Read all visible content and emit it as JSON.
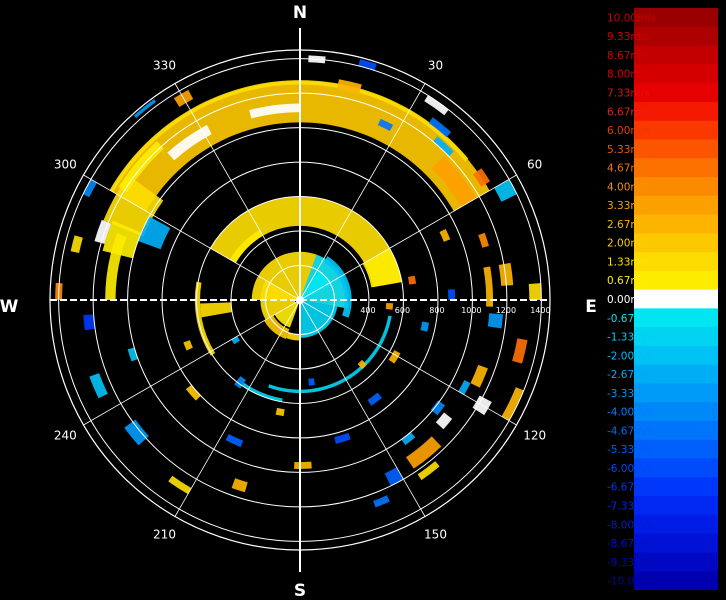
{
  "chart_data": {
    "type": "polar-radar-ppi",
    "cardinals": {
      "north": "N",
      "east": "E",
      "south": "S",
      "west": "W"
    },
    "azimuth_labels": [
      {
        "angle": 30,
        "text": "30"
      },
      {
        "angle": 60,
        "text": "60"
      },
      {
        "angle": 120,
        "text": "120"
      },
      {
        "angle": 150,
        "text": "150"
      },
      {
        "angle": 210,
        "text": "210"
      },
      {
        "angle": 240,
        "text": "240"
      },
      {
        "angle": 300,
        "text": "300"
      },
      {
        "angle": 330,
        "text": "330"
      }
    ],
    "range_rings": [
      200,
      400,
      600,
      800,
      1000,
      1200,
      1400
    ],
    "range_labels": [
      {
        "value": 400,
        "text": "400"
      },
      {
        "value": 600,
        "text": "600"
      },
      {
        "value": 800,
        "text": "800"
      },
      {
        "value": 1000,
        "text": "1000"
      },
      {
        "value": 1200,
        "text": "1200"
      },
      {
        "value": 1400,
        "text": "1400"
      }
    ],
    "colorbar": {
      "labels": [
        "10.00m/s",
        "9.33m/s",
        "8.67m/s",
        "8.00m/s",
        "7.33m/s",
        "6.67m/s",
        "6.00m/s",
        "5.33m/s",
        "4.67m/s",
        "4.00m/s",
        "3.33m/s",
        "2.67m/s",
        "2.00m/s",
        "1.33m/s",
        "0.67m/s",
        "0.00m/s",
        "-0.67m/s",
        "-1.33m/s",
        "-2.00m/s",
        "-2.67m/s",
        "-3.33m/s",
        "-4.00m/s",
        "-4.67m/s",
        "-5.33m/s",
        "-6.00m/s",
        "-6.67m/s",
        "-7.33m/s",
        "-8.00m/s",
        "-8.67m/s",
        "-9.33m/s",
        "-10.00m/s"
      ],
      "colors": [
        "#9a0000",
        "#ad0000",
        "#c20000",
        "#d40000",
        "#e60000",
        "#f51800",
        "#fa3800",
        "#fc5500",
        "#fc7000",
        "#fc8a00",
        "#fca000",
        "#fcb400",
        "#fcc800",
        "#fcdc00",
        "#fcec00",
        "#ffffff",
        "#00e6f0",
        "#00d4f2",
        "#00c2f4",
        "#00aef6",
        "#009af8",
        "#0088f9",
        "#0074fa",
        "#0060fb",
        "#004cfc",
        "#0038fb",
        "#0028f3",
        "#001ce6",
        "#0012d6",
        "#0008c4",
        "#0000b0"
      ],
      "label_colors": [
        "#c80000",
        "#cc0000",
        "#d20000",
        "#d80000",
        "#de1010",
        "#e42020",
        "#ea3a00",
        "#ee5a00",
        "#f07600",
        "#f39000",
        "#f6a600",
        "#f8ba00",
        "#fad000",
        "#fce200",
        "#fcf000",
        "#ffffff",
        "#00e4f0",
        "#00d0f0",
        "#00bef2",
        "#00aaf4",
        "#0096f6",
        "#0082f8",
        "#006ef8",
        "#005cf8",
        "#0048f8",
        "#0036f0",
        "#0028e4",
        "#001cd6",
        "#0012c6",
        "#000ab6",
        "#0004a6"
      ]
    },
    "max_range": 1450,
    "cells": [
      {
        "az_from": 300,
        "az_to": 420,
        "r_from": 1030,
        "r_to": 1270,
        "v": 2.2
      },
      {
        "az_from": 292,
        "az_to": 306,
        "r_from": 980,
        "r_to": 1230,
        "v": 1.2
      },
      {
        "az_from": 284,
        "az_to": 293,
        "r_from": 1000,
        "r_to": 1180,
        "v": 1.0
      },
      {
        "az_from": 302,
        "az_to": 318,
        "r_from": 1180,
        "r_to": 1240,
        "v": 0.4
      },
      {
        "az_from": 405,
        "az_to": 420,
        "r_from": 1080,
        "r_to": 1180,
        "v": 3.2
      },
      {
        "az_from": 300,
        "az_to": 410,
        "r_from": 1250,
        "r_to": 1275,
        "v": 1.6
      },
      {
        "az_from": 290,
        "az_to": 299,
        "r_from": 860,
        "r_to": 1000,
        "v": -2.6
      },
      {
        "az_from": 270,
        "az_to": 290,
        "r_from": 1070,
        "r_to": 1130,
        "v": 1.0
      },
      {
        "az_from": 318,
        "az_to": 332,
        "r_from": 1090,
        "r_to": 1150,
        "v": 0.0
      },
      {
        "az_from": 345,
        "az_to": 360,
        "r_from": 1090,
        "r_to": 1140,
        "v": 0.0
      },
      {
        "az_from": 286,
        "az_to": 292,
        "r_from": 1180,
        "r_to": 1240,
        "v": 0.0
      },
      {
        "az_from": 300,
        "az_to": 440,
        "r_from": 430,
        "r_to": 600,
        "v": 1.6
      },
      {
        "az_from": 420,
        "az_to": 440,
        "r_from": 420,
        "r_to": 600,
        "v": 0.9
      },
      {
        "az_from": 300,
        "az_to": 330,
        "r_from": 430,
        "r_to": 470,
        "v": 0.8
      },
      {
        "az_from": 270,
        "az_to": 460,
        "r_from": 0,
        "r_to": 280,
        "v": 1.3
      },
      {
        "az_from": 380,
        "az_to": 460,
        "r_from": 0,
        "r_to": 280,
        "v": -1.6
      },
      {
        "az_from": 392,
        "az_to": 425,
        "r_from": 0,
        "r_to": 200,
        "v": -0.7
      },
      {
        "az_from": 392,
        "az_to": 470,
        "r_from": 260,
        "r_to": 300,
        "v": -2.0
      },
      {
        "az_from": 460,
        "az_to": 540,
        "r_from": 0,
        "r_to": 220,
        "v": -1.6
      },
      {
        "az_from": 460,
        "az_to": 560,
        "r_from": 520,
        "r_to": 540,
        "v": -1.3
      },
      {
        "az_from": 550,
        "az_to": 575,
        "r_from": 580,
        "r_to": 600,
        "v": -1.6
      },
      {
        "az_from": 540,
        "az_to": 560,
        "r_from": 200,
        "r_to": 235,
        "v": 1.3
      },
      {
        "az_from": 560,
        "az_to": 600,
        "r_from": 180,
        "r_to": 240,
        "v": 2.0
      },
      {
        "az_from": 600,
        "az_to": 660,
        "r_from": 30,
        "r_to": 230,
        "v": 1.3
      },
      {
        "az_from": 560,
        "az_to": 600,
        "r_from": 0,
        "r_to": 170,
        "v": 0.5
      },
      {
        "az_from": 238,
        "az_to": 280,
        "r_from": 580,
        "r_to": 610,
        "v": 1.3
      },
      {
        "az_from": 260,
        "az_to": 268,
        "r_from": 400,
        "r_to": 580,
        "v": 1.2
      },
      {
        "az_from": 440,
        "az_to": 452,
        "r_from": 1080,
        "r_to": 1120,
        "v": 2.4
      },
      {
        "az_from": 440,
        "az_to": 446,
        "r_from": 1170,
        "r_to": 1240,
        "v": 3.0
      },
      {
        "az_from": 476,
        "az_to": 480,
        "r_from": 1060,
        "r_to": 1100,
        "v": -2.8
      },
      {
        "az_from": 472,
        "az_to": 480,
        "r_from": 1350,
        "r_to": 1400,
        "v": 3.0
      },
      {
        "az_from": 478,
        "az_to": 482,
        "r_from": 1180,
        "r_to": 1260,
        "v": 0.0
      },
      {
        "az_from": 496,
        "az_to": 506,
        "r_from": 1100,
        "r_to": 1180,
        "v": 3.2
      },
      {
        "az_from": 500,
        "az_to": 506,
        "r_from": 1220,
        "r_to": 1260,
        "v": 1.4
      },
      {
        "az_from": 486,
        "az_to": 490,
        "r_from": 990,
        "r_to": 1040,
        "v": -4.0
      },
      {
        "az_from": 414,
        "az_to": 418,
        "r_from": 1240,
        "r_to": 1300,
        "v": 4.5
      },
      {
        "az_from": 392,
        "az_to": 398,
        "r_from": 1360,
        "r_to": 1400,
        "v": 0.0
      },
      {
        "az_from": 328,
        "az_to": 332,
        "r_from": 1320,
        "r_to": 1380,
        "v": 3.4
      },
      {
        "az_from": 318,
        "az_to": 324,
        "r_from": 1420,
        "r_to": 1440,
        "v": -3.6
      },
      {
        "az_from": 296,
        "az_to": 300,
        "r_from": 1360,
        "r_to": 1400,
        "v": -4.2
      },
      {
        "az_from": 244,
        "az_to": 250,
        "r_from": 1240,
        "r_to": 1300,
        "v": -1.8
      },
      {
        "az_from": 228,
        "az_to": 234,
        "r_from": 1180,
        "r_to": 1260,
        "v": -3.0
      },
      {
        "az_from": 210,
        "az_to": 216,
        "r_from": 1260,
        "r_to": 1300,
        "v": 1.6
      },
      {
        "az_from": 196,
        "az_to": 200,
        "r_from": 1100,
        "r_to": 1160,
        "v": 2.4
      },
      {
        "az_from": 156,
        "az_to": 160,
        "r_from": 1240,
        "r_to": 1280,
        "v": -4.6
      },
      {
        "az_from": 150,
        "az_to": 154,
        "r_from": 1120,
        "r_to": 1200,
        "v": -5.0
      },
      {
        "az_from": 140,
        "az_to": 144,
        "r_from": 1000,
        "r_to": 1040,
        "v": -2.5
      },
      {
        "az_from": 128,
        "az_to": 132,
        "r_from": 1060,
        "r_to": 1120,
        "v": 0.0
      },
      {
        "az_from": 110,
        "az_to": 116,
        "r_from": 1100,
        "r_to": 1160,
        "v": 2.8
      },
      {
        "az_from": 100,
        "az_to": 106,
        "r_from": 1280,
        "r_to": 1340,
        "v": 4.6
      },
      {
        "az_from": 86,
        "az_to": 90,
        "r_from": 1330,
        "r_to": 1400,
        "v": 1.4
      },
      {
        "az_from": 60,
        "az_to": 64,
        "r_from": 1300,
        "r_to": 1400,
        "v": -2.0
      },
      {
        "az_from": 40,
        "az_to": 46,
        "r_from": 1200,
        "r_to": 1240,
        "v": -2.8
      },
      {
        "az_from": 36,
        "az_to": 42,
        "r_from": 1270,
        "r_to": 1310,
        "v": -4.8
      },
      {
        "az_from": 24,
        "az_to": 28,
        "r_from": 1110,
        "r_to": 1150,
        "v": -4.4
      },
      {
        "az_from": 10,
        "az_to": 16,
        "r_from": 1240,
        "r_to": 1300,
        "v": 2.8
      },
      {
        "az_from": 2,
        "az_to": 6,
        "r_from": 1380,
        "r_to": 1420,
        "v": 0.0
      },
      {
        "az_from": 14,
        "az_to": 18,
        "r_from": 1400,
        "r_to": 1440,
        "v": -6.2
      },
      {
        "az_from": 70,
        "az_to": 74,
        "r_from": 1100,
        "r_to": 1140,
        "v": 3.8
      },
      {
        "az_from": 94,
        "az_to": 98,
        "r_from": 1100,
        "r_to": 1180,
        "v": -3.6
      },
      {
        "az_from": 118,
        "az_to": 124,
        "r_from": 620,
        "r_to": 660,
        "v": 2.6
      },
      {
        "az_from": 140,
        "az_to": 146,
        "r_from": 700,
        "r_to": 740,
        "v": -5.4
      },
      {
        "az_from": 160,
        "az_to": 166,
        "r_from": 820,
        "r_to": 860,
        "v": -5.8
      },
      {
        "az_from": 176,
        "az_to": 182,
        "r_from": 940,
        "r_to": 980,
        "v": 3.0
      },
      {
        "az_from": 188,
        "az_to": 192,
        "r_from": 640,
        "r_to": 680,
        "v": 2.2
      },
      {
        "az_from": 202,
        "az_to": 208,
        "r_from": 880,
        "r_to": 920,
        "v": -5.0
      },
      {
        "az_from": 214,
        "az_to": 218,
        "r_from": 560,
        "r_to": 620,
        "v": -4.2
      },
      {
        "az_from": 226,
        "az_to": 232,
        "r_from": 800,
        "r_to": 840,
        "v": 2.0
      },
      {
        "az_from": 250,
        "az_to": 254,
        "r_from": 1000,
        "r_to": 1040,
        "v": -1.8
      },
      {
        "az_from": 262,
        "az_to": 266,
        "r_from": 1200,
        "r_to": 1260,
        "v": -6.4
      },
      {
        "az_from": 270,
        "az_to": 274,
        "r_from": 1380,
        "r_to": 1420,
        "v": 3.8
      },
      {
        "az_from": 282,
        "az_to": 286,
        "r_from": 1310,
        "r_to": 1360,
        "v": 1.4
      },
      {
        "az_from": 78,
        "az_to": 82,
        "r_from": 640,
        "r_to": 680,
        "v": 4.8
      },
      {
        "az_from": 86,
        "az_to": 90,
        "r_from": 860,
        "r_to": 900,
        "v": -6.0
      },
      {
        "az_from": 64,
        "az_to": 68,
        "r_from": 900,
        "r_to": 940,
        "v": 2.6
      },
      {
        "az_from": 92,
        "az_to": 96,
        "r_from": 500,
        "r_to": 540,
        "v": 3.4
      },
      {
        "az_from": 100,
        "az_to": 104,
        "r_from": 720,
        "r_to": 760,
        "v": -3.2
      },
      {
        "az_from": 134,
        "az_to": 138,
        "r_from": 500,
        "r_to": 540,
        "v": 2.4
      },
      {
        "az_from": 170,
        "az_to": 174,
        "r_from": 460,
        "r_to": 500,
        "v": -5.2
      },
      {
        "az_from": 236,
        "az_to": 240,
        "r_from": 420,
        "r_to": 460,
        "v": -2.8
      },
      {
        "az_from": 246,
        "az_to": 250,
        "r_from": 680,
        "r_to": 720,
        "v": 2.2
      }
    ]
  }
}
